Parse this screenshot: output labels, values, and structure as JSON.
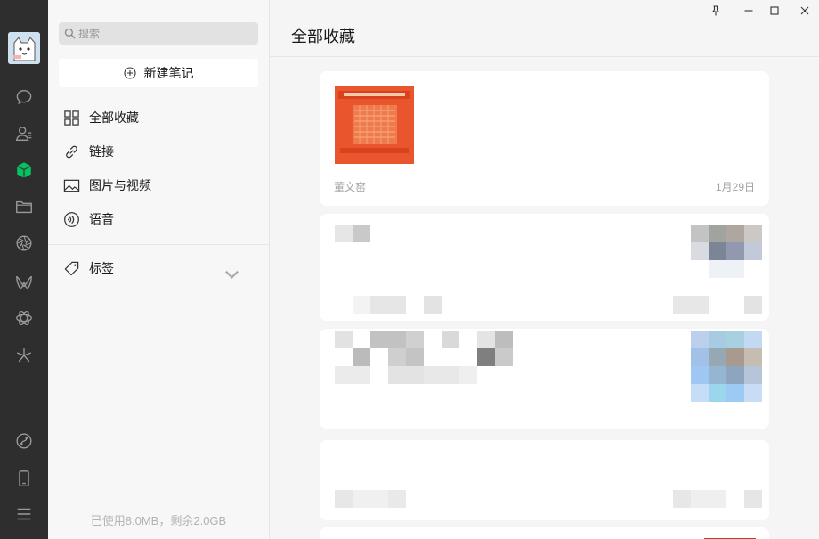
{
  "sidebar": {
    "search_placeholder": "搜索",
    "new_note_label": "新建笔记",
    "nav": {
      "all": "全部收藏",
      "links": "链接",
      "media": "图片与视频",
      "voice": "语音",
      "tags": "标签"
    },
    "storage": "已使用8.0MB，剩余2.0GB"
  },
  "main": {
    "title": "全部收藏",
    "cards": [
      {
        "source": "董文窑",
        "date": "1月29日"
      }
    ]
  },
  "colors": {
    "rail": "#2e2e2e",
    "accent": "#07c160",
    "thumb": "#e8522a"
  }
}
